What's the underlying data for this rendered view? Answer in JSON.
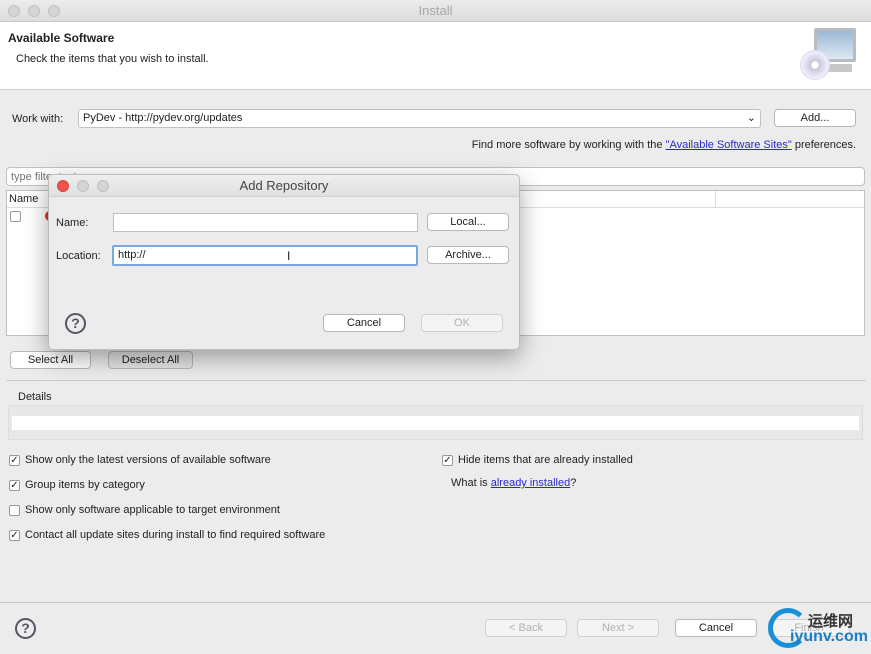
{
  "window": {
    "title": "Install"
  },
  "header": {
    "title": "Available Software",
    "subtitle": "Check the items that you wish to install."
  },
  "work_with": {
    "label": "Work with:",
    "value": "PyDev - http://pydev.org/updates",
    "add_label": "Add...",
    "hint_prefix": "Find more software by working with the ",
    "hint_link": "\"Available Software Sites\"",
    "hint_suffix": " preferences."
  },
  "filter": {
    "placeholder": "type filter text"
  },
  "table": {
    "col_name": "Name"
  },
  "buttons": {
    "select_all": "Select All",
    "deselect_all": "Deselect All"
  },
  "details": {
    "label": "Details"
  },
  "options": [
    {
      "label": "Show only the latest versions of available software",
      "checked": true
    },
    {
      "label": "Group items by category",
      "checked": true
    },
    {
      "label": "Show only software applicable to target environment",
      "checked": false
    },
    {
      "label": "Contact all update sites during install to find required software",
      "checked": true
    }
  ],
  "hide_installed": {
    "label": "Hide items that are already installed",
    "checked": true
  },
  "what_is": {
    "prefix": "What is ",
    "link": "already installed",
    "suffix": "?"
  },
  "footer": {
    "back": "< Back",
    "next": "Next >",
    "cancel": "Cancel",
    "finish": "Finish"
  },
  "dialog": {
    "title": "Add Repository",
    "name_label": "Name:",
    "name_value": "",
    "location_label": "Location:",
    "location_value": "http://",
    "local": "Local...",
    "archive": "Archive...",
    "cancel": "Cancel",
    "ok": "OK"
  },
  "watermark": {
    "text1": "运维网",
    "text2": "iyunv.com"
  }
}
